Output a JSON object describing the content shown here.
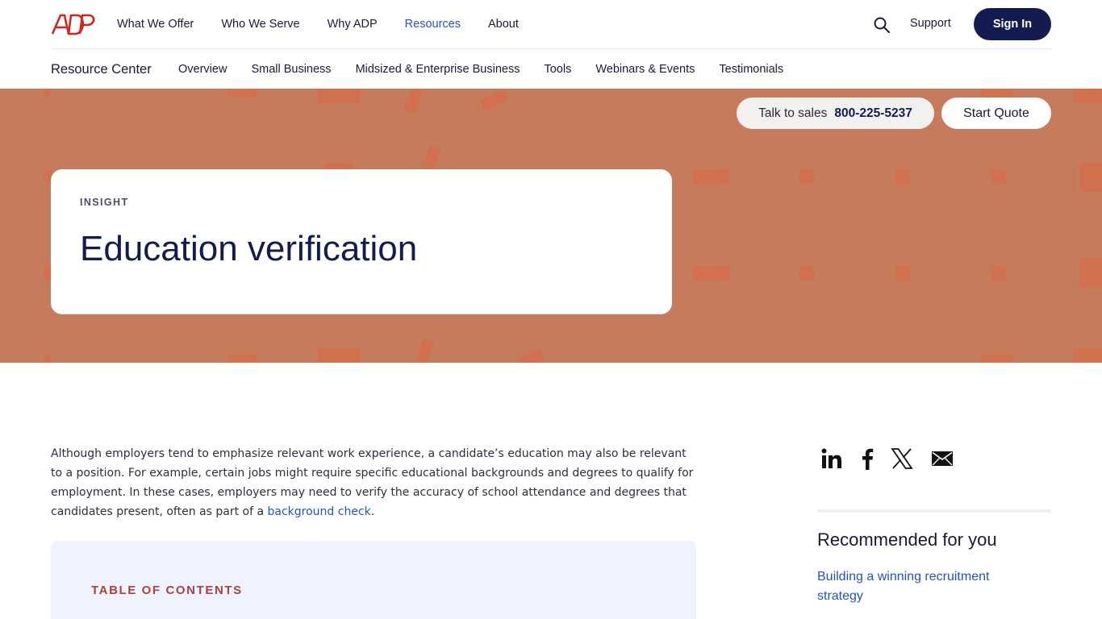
{
  "brand": {
    "logo_text": "ADP",
    "logo_color": "#d0271d"
  },
  "topnav": {
    "links": [
      {
        "label": "What We Offer"
      },
      {
        "label": "Who We Serve"
      },
      {
        "label": "Why ADP"
      },
      {
        "label": "Resources",
        "active": true
      },
      {
        "label": "About"
      }
    ],
    "support_label": "Support",
    "signin_label": "Sign In"
  },
  "subnav": {
    "title": "Resource Center",
    "links": [
      {
        "label": "Overview"
      },
      {
        "label": "Small Business"
      },
      {
        "label": "Midsized & Enterprise Business"
      },
      {
        "label": "Tools"
      },
      {
        "label": "Webinars & Events"
      },
      {
        "label": "Testimonials"
      }
    ]
  },
  "hero": {
    "talk_label": "Talk to sales",
    "phone": "800-225-5237",
    "quote_label": "Start Quote",
    "eyebrow": "INSIGHT",
    "title": "Education verification",
    "background_color": "#c67b5c"
  },
  "article": {
    "intro_text": "Although employers tend to emphasize relevant work experience, a candidate’s education may also be relevant to a position. For example, certain jobs might require specific educational backgrounds and degrees to qualify for employment. In these cases, employers may need to verify the accuracy of school attendance and degrees that candidates present, often as part of a ",
    "intro_link": "background check",
    "intro_end": ".",
    "toc_title": "TABLE OF CONTENTS"
  },
  "sidebar": {
    "share": [
      {
        "name": "linkedin-icon"
      },
      {
        "name": "facebook-icon"
      },
      {
        "name": "x-icon"
      },
      {
        "name": "email-icon"
      }
    ],
    "recommend_heading": "Recommended for you",
    "recommend_link": "Building a winning recruitment strategy"
  },
  "colors": {
    "navy": "#121c4e",
    "link_blue": "#1f54c4",
    "toc_red": "#b0403a",
    "toc_bg": "#eef3fd"
  }
}
